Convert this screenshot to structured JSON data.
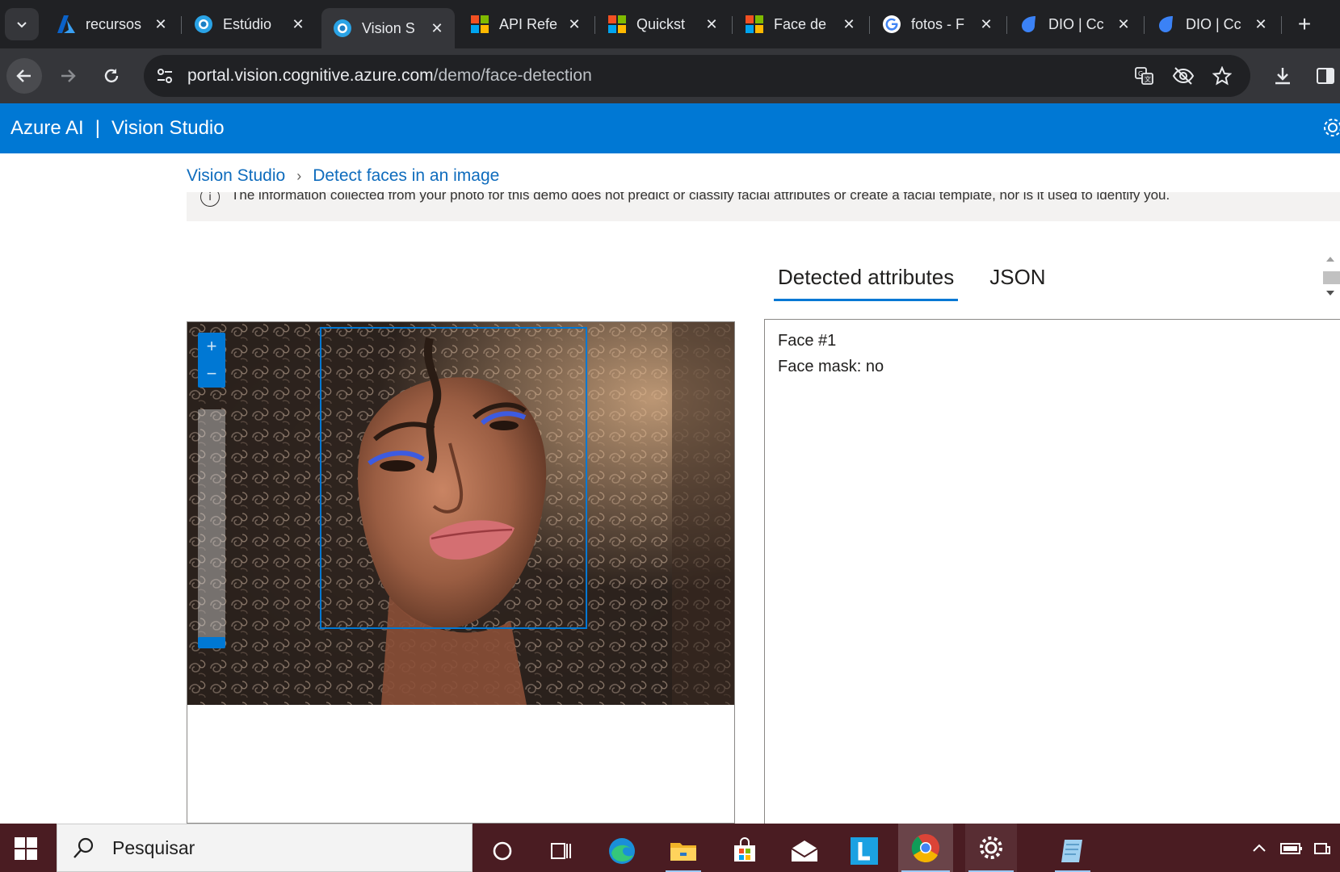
{
  "browser": {
    "tabs": [
      {
        "title": "recursos",
        "icon": "azure-icon",
        "active": false
      },
      {
        "title": "Estúdio",
        "icon": "vision-studio-icon",
        "active": false
      },
      {
        "title": "Vision S",
        "icon": "vision-studio-icon",
        "active": true
      },
      {
        "title": "API Refe",
        "icon": "microsoft-icon",
        "active": false
      },
      {
        "title": "Quickst",
        "icon": "microsoft-icon",
        "active": false
      },
      {
        "title": "Face de",
        "icon": "microsoft-icon",
        "active": false
      },
      {
        "title": "fotos - F",
        "icon": "google-icon",
        "active": false
      },
      {
        "title": "DIO | Cc",
        "icon": "dio-icon",
        "active": false
      },
      {
        "title": "DIO | Cc",
        "icon": "dio-icon",
        "active": false
      }
    ],
    "url_host": "portal.vision.cognitive.azure.com",
    "url_path": "/demo/face-detection"
  },
  "app": {
    "brand": "Azure AI",
    "separator": "|",
    "product": "Vision Studio"
  },
  "breadcrumb": {
    "root": "Vision Studio",
    "current": "Detect faces in an image"
  },
  "notice": "The information collected from your photo for this demo does not predict or classify facial attributes or create a facial template, nor is it used to identify you.",
  "zoom": {
    "plus": "+",
    "minus": "−"
  },
  "result_tabs": {
    "attributes": "Detected attributes",
    "json": "JSON"
  },
  "results": {
    "face_label": "Face #1",
    "mask_label": "Face mask: no"
  },
  "taskbar": {
    "search_placeholder": "Pesquisar"
  },
  "colors": {
    "azure_blue": "#0078d4",
    "taskbar": "#4a1c22",
    "chrome_dark": "#202124"
  }
}
